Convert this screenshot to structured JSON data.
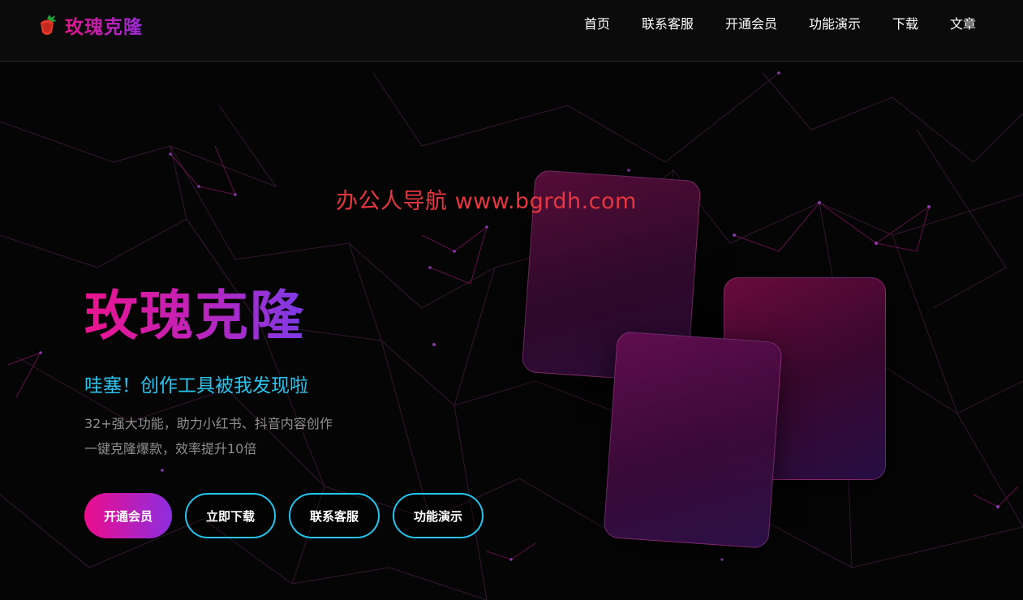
{
  "header": {
    "brand_name": "玫瑰克隆",
    "logo_icon": "rose-logo-icon",
    "nav": [
      {
        "label": "首页"
      },
      {
        "label": "联系客服"
      },
      {
        "label": "开通会员"
      },
      {
        "label": "功能演示"
      },
      {
        "label": "下载"
      },
      {
        "label": "文章"
      }
    ]
  },
  "hero": {
    "watermark": "办公人导航  www.bgrdh.com",
    "title": "玫瑰克隆",
    "subtitle": "哇塞！创作工具被我发现啦",
    "desc_lines": [
      "32+强大功能，助力小红书、抖音内容创作",
      "一键克隆爆款，效率提升10倍"
    ]
  },
  "buttons": {
    "join_member": "开通会员",
    "download_now": "立即下载",
    "contact_service": "联系客服",
    "feature_demo": "功能演示"
  },
  "colors": {
    "accent_pink": "#ec0d8c",
    "accent_purple": "#8d2ee0",
    "accent_cyan": "#29c4ee",
    "watermark_red": "#e8363f",
    "background": "#050505"
  }
}
